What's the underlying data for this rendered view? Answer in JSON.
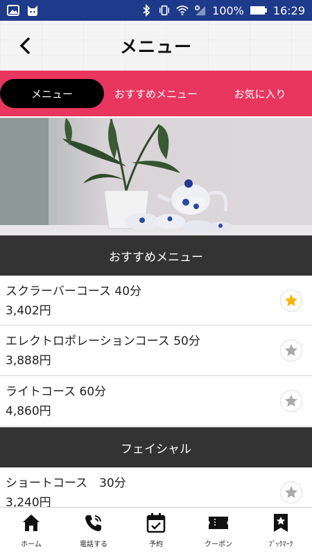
{
  "status_bar": {
    "battery": "100%",
    "time": "16:29"
  },
  "header": {
    "title": "メニュー"
  },
  "tabs": [
    {
      "label": "メニュー",
      "active": true
    },
    {
      "label": "おすすめメニュー",
      "active": false
    },
    {
      "label": "お気に入り",
      "active": false
    }
  ],
  "sections": [
    {
      "title": "おすすめメニュー",
      "items": [
        {
          "name": "スクラーバーコース 40分",
          "price": "3,402円",
          "favorite": true
        },
        {
          "name": "エレクトロポレーションコース 50分",
          "price": "3,888円",
          "favorite": false
        },
        {
          "name": "ライトコース 60分",
          "price": "4,860円",
          "favorite": false
        }
      ]
    },
    {
      "title": "フェイシャル",
      "items": [
        {
          "name": "ショートコース　30分",
          "price": "3,240円",
          "favorite": false
        }
      ]
    }
  ],
  "bottom_nav": [
    {
      "label": "ホーム",
      "icon": "home-icon"
    },
    {
      "label": "電話する",
      "icon": "phone-icon"
    },
    {
      "label": "予約",
      "icon": "calendar-check-icon"
    },
    {
      "label": "クーポン",
      "icon": "ticket-icon"
    },
    {
      "label": "ﾌﾞｯｸﾏｰｸ",
      "icon": "bookmark-star-icon"
    }
  ],
  "colors": {
    "status_bar": "#1e3a8a",
    "tab_bar": "#e8365f",
    "active_tab": "#000000",
    "section_header": "#333333",
    "star_active": "#f5b400",
    "star_inactive": "#aaaaaa"
  }
}
